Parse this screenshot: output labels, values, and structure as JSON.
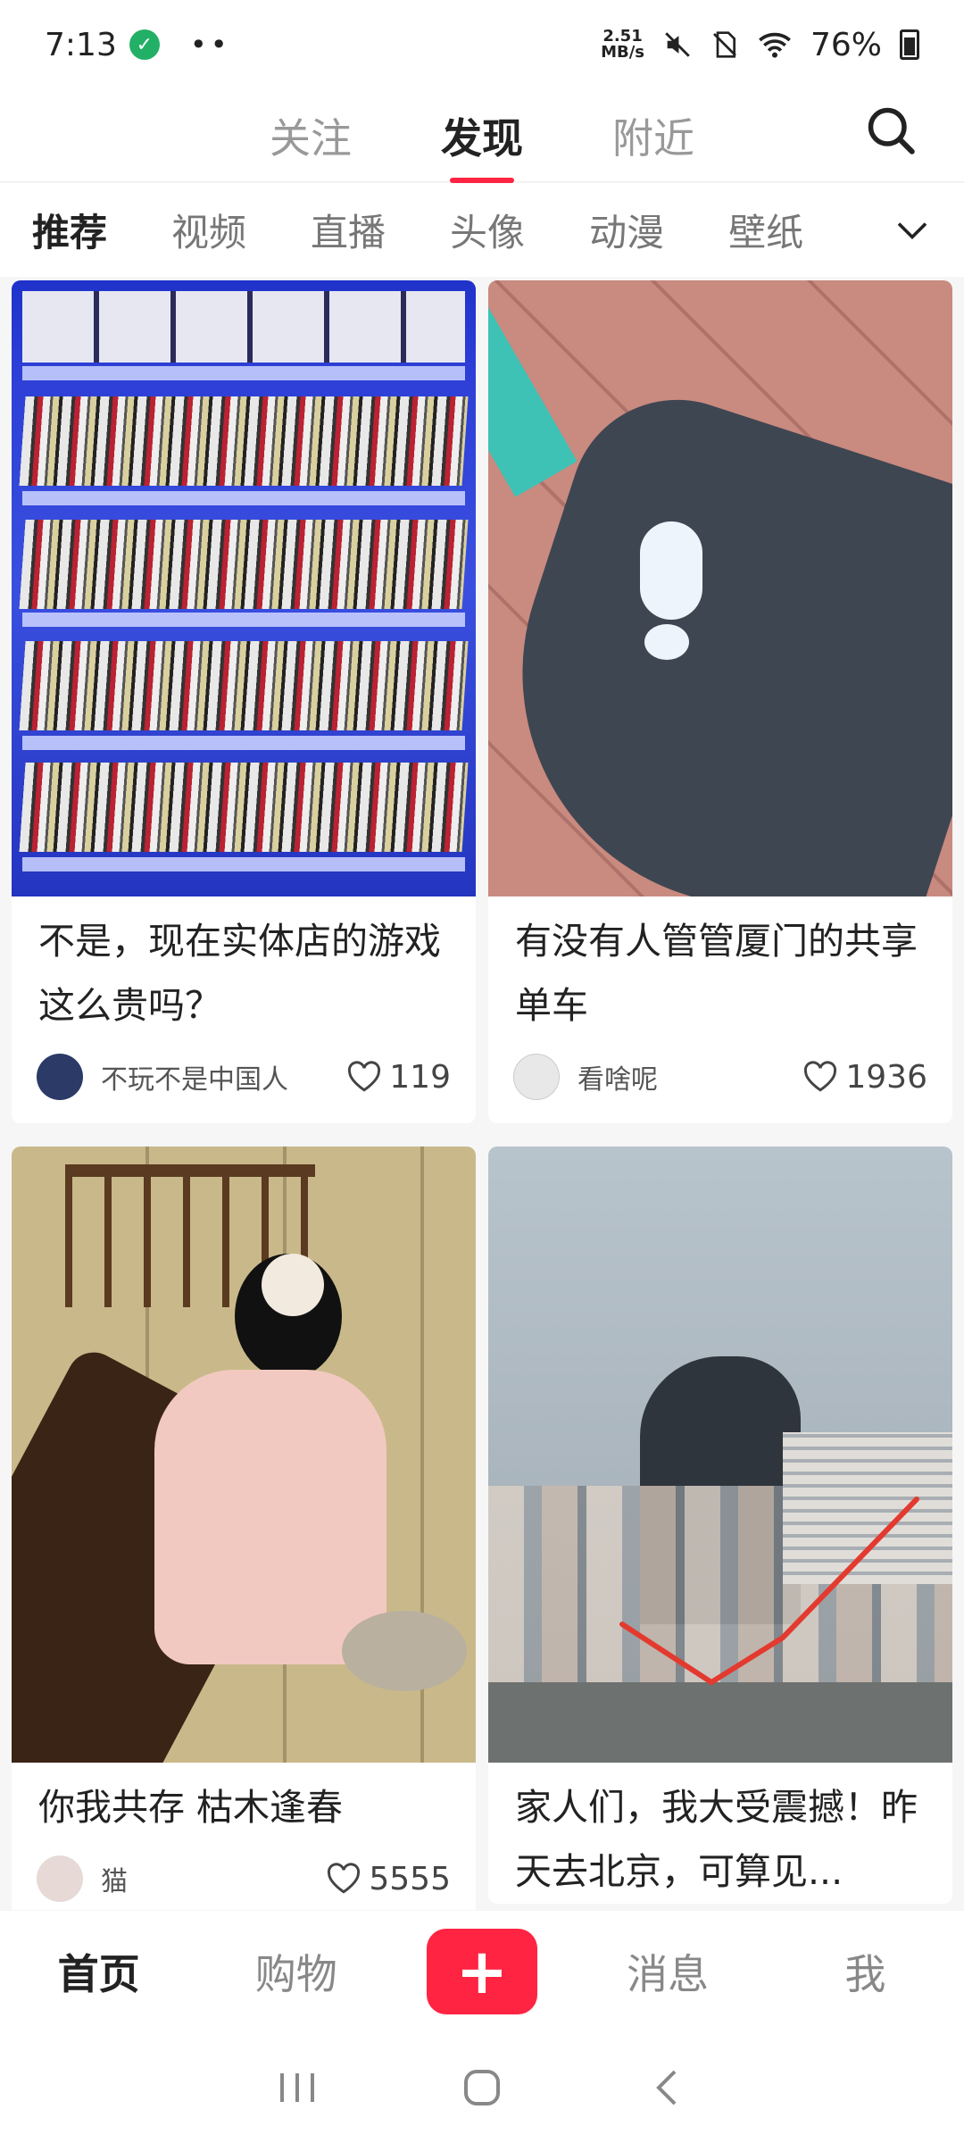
{
  "status_bar": {
    "time": "7:13",
    "net_speed_value": "2.51",
    "net_speed_unit": "MB/s",
    "battery": "76%"
  },
  "top_tabs": [
    {
      "label": "关注",
      "active": false
    },
    {
      "label": "发现",
      "active": true
    },
    {
      "label": "附近",
      "active": false
    }
  ],
  "categories": [
    {
      "label": "推荐",
      "active": true
    },
    {
      "label": "视频",
      "active": false
    },
    {
      "label": "直播",
      "active": false
    },
    {
      "label": "头像",
      "active": false
    },
    {
      "label": "动漫",
      "active": false
    },
    {
      "label": "壁纸",
      "active": false
    }
  ],
  "feed": [
    {
      "title": "不是，现在实体店的游戏这么贵吗？",
      "author": "不玩不是中国人",
      "likes": "119",
      "image": "game-shelves",
      "avatar_color": "#2b3a66"
    },
    {
      "title": "有没有人管管厦门的共享单车",
      "author": "看啥呢",
      "likes": "1936",
      "image": "bike-seat",
      "avatar_color": "#e8e8e8"
    },
    {
      "title": "你我共存 枯木逢春",
      "author": "猫",
      "likes": "5555",
      "image": "guzheng-girl",
      "avatar_color": "#e6d9d6"
    },
    {
      "title": "家人们，我大受震撼！昨天去北京，可算见...",
      "author": "",
      "likes": "",
      "image": "beijing-building",
      "avatar_color": ""
    }
  ],
  "bottom_nav": {
    "home": "首页",
    "shop": "购物",
    "plus": "+",
    "messages": "消息",
    "me": "我"
  },
  "colors": {
    "accent": "#ff2442"
  }
}
